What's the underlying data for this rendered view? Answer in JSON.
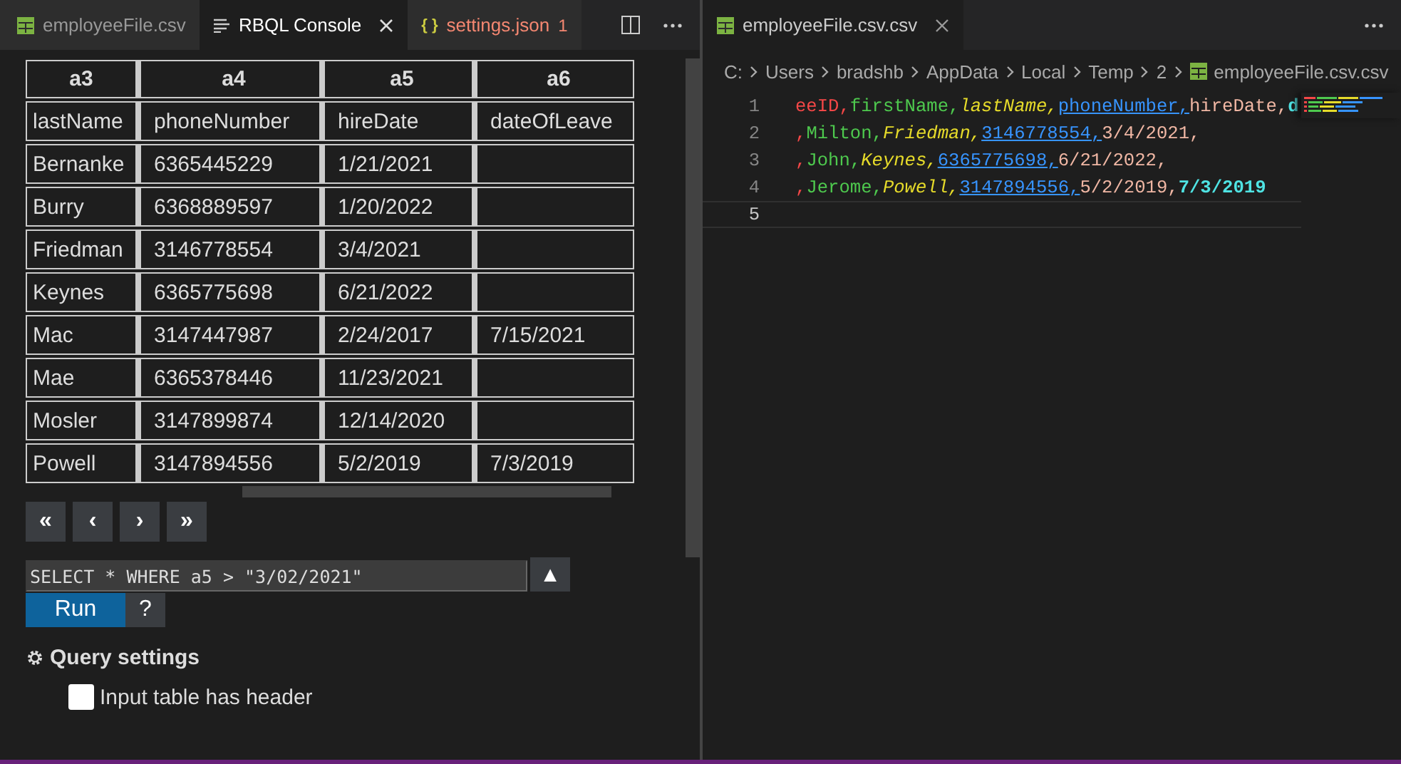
{
  "left_pane": {
    "tabs": [
      {
        "label": "employeeFile.csv",
        "selected": false,
        "has_close": false
      },
      {
        "label": "RBQL Console",
        "selected": true,
        "has_close": true
      },
      {
        "label": "settings.json",
        "icon_text": "{ }",
        "selected": false,
        "has_close": false,
        "error": true,
        "badge": "1"
      }
    ],
    "table": {
      "columns": [
        "a3",
        "a4",
        "a5",
        "a6"
      ],
      "rows": [
        [
          "lastName",
          "phoneNumber",
          "hireDate",
          "dateOfLeave"
        ],
        [
          "Bernanke",
          "6365445229",
          "1/21/2021",
          ""
        ],
        [
          "Burry",
          "6368889597",
          "1/20/2022",
          ""
        ],
        [
          "Friedman",
          "3146778554",
          "3/4/2021",
          ""
        ],
        [
          "Keynes",
          "6365775698",
          "6/21/2022",
          ""
        ],
        [
          "Mac",
          "3147447987",
          "2/24/2017",
          "7/15/2021"
        ],
        [
          "Mae",
          "6365378446",
          "11/23/2021",
          ""
        ],
        [
          "Mosler",
          "3147899874",
          "12/14/2020",
          ""
        ],
        [
          "Powell",
          "3147894556",
          "5/2/2019",
          "7/3/2019"
        ]
      ]
    },
    "pager": [
      "«",
      "‹",
      "›",
      "»"
    ],
    "query": {
      "value": "SELECT * WHERE a5 > \"3/02/2021\"",
      "history_button": "▲"
    },
    "run_button": "Run",
    "help_button": "?",
    "settings": {
      "title": "Query settings",
      "options": [
        {
          "label": "Input table has header",
          "checked": false
        }
      ]
    }
  },
  "right_pane": {
    "tab": {
      "label": "employeeFile.csv.csv",
      "selected": true
    },
    "breadcrumbs": [
      "C:",
      "Users",
      "bradshb",
      "AppData",
      "Local",
      "Temp",
      "2",
      "employeeFile.csv.csv"
    ],
    "lines": [
      {
        "number": "1",
        "tokens": [
          {
            "text": "eeID,",
            "kind": "c0"
          },
          {
            "text": "firstName,",
            "kind": "c1"
          },
          {
            "text": "lastName,",
            "kind": "c2"
          },
          {
            "text": "phoneNumber,",
            "kind": "c3"
          },
          {
            "text": "hireDate,",
            "kind": "c4"
          },
          {
            "text": "d",
            "kind": "c5"
          }
        ]
      },
      {
        "number": "2",
        "tokens": [
          {
            "text": ",",
            "kind": "c0"
          },
          {
            "text": "Milton,",
            "kind": "c1"
          },
          {
            "text": "Friedman,",
            "kind": "c2"
          },
          {
            "text": "3146778554,",
            "kind": "c3"
          },
          {
            "text": "3/4/2021,",
            "kind": "c4"
          }
        ]
      },
      {
        "number": "3",
        "tokens": [
          {
            "text": ",",
            "kind": "c0"
          },
          {
            "text": "John,",
            "kind": "c1"
          },
          {
            "text": "Keynes,",
            "kind": "c2"
          },
          {
            "text": "6365775698,",
            "kind": "c3"
          },
          {
            "text": "6/21/2022,",
            "kind": "c4"
          }
        ]
      },
      {
        "number": "4",
        "tokens": [
          {
            "text": ",",
            "kind": "c0"
          },
          {
            "text": "Jerome,",
            "kind": "c1"
          },
          {
            "text": "Powell,",
            "kind": "c2"
          },
          {
            "text": "3147894556,",
            "kind": "c3"
          },
          {
            "text": "5/2/2019,",
            "kind": "c4"
          },
          {
            "text": "7/3/2019",
            "kind": "c5"
          }
        ]
      },
      {
        "number": "5",
        "current": true
      }
    ]
  }
}
